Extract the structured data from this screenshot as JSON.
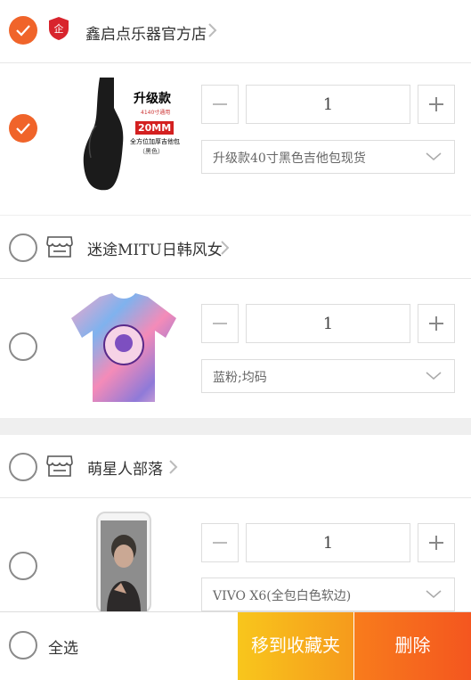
{
  "stores": [
    {
      "name": "鑫启点乐器官方店",
      "checked": true,
      "item": {
        "qty": "1",
        "variant": "升级款40寸黑色吉他包现货",
        "checked": true,
        "image": {
          "title": "升级款",
          "sub": "4140寸通用",
          "thickness": "20MM",
          "desc": "全方位加厚吉他包",
          "color": "（黑色）"
        }
      }
    },
    {
      "name": "迷途MITU日韩风女",
      "checked": false,
      "item": {
        "qty": "1",
        "variant": "蓝粉;均码",
        "checked": false
      }
    },
    {
      "name": "萌星人部落",
      "checked": false,
      "item": {
        "qty": "1",
        "variant": "VIVO X6(全包白色软边)",
        "checked": false
      }
    }
  ],
  "footer": {
    "select_all": "全选",
    "move_to_favorites": "移到收藏夹",
    "delete": "删除"
  },
  "colors": {
    "accent": "#f0642a",
    "favorites_btn": "#f8b41c",
    "delete_btn": "#f4561f"
  }
}
